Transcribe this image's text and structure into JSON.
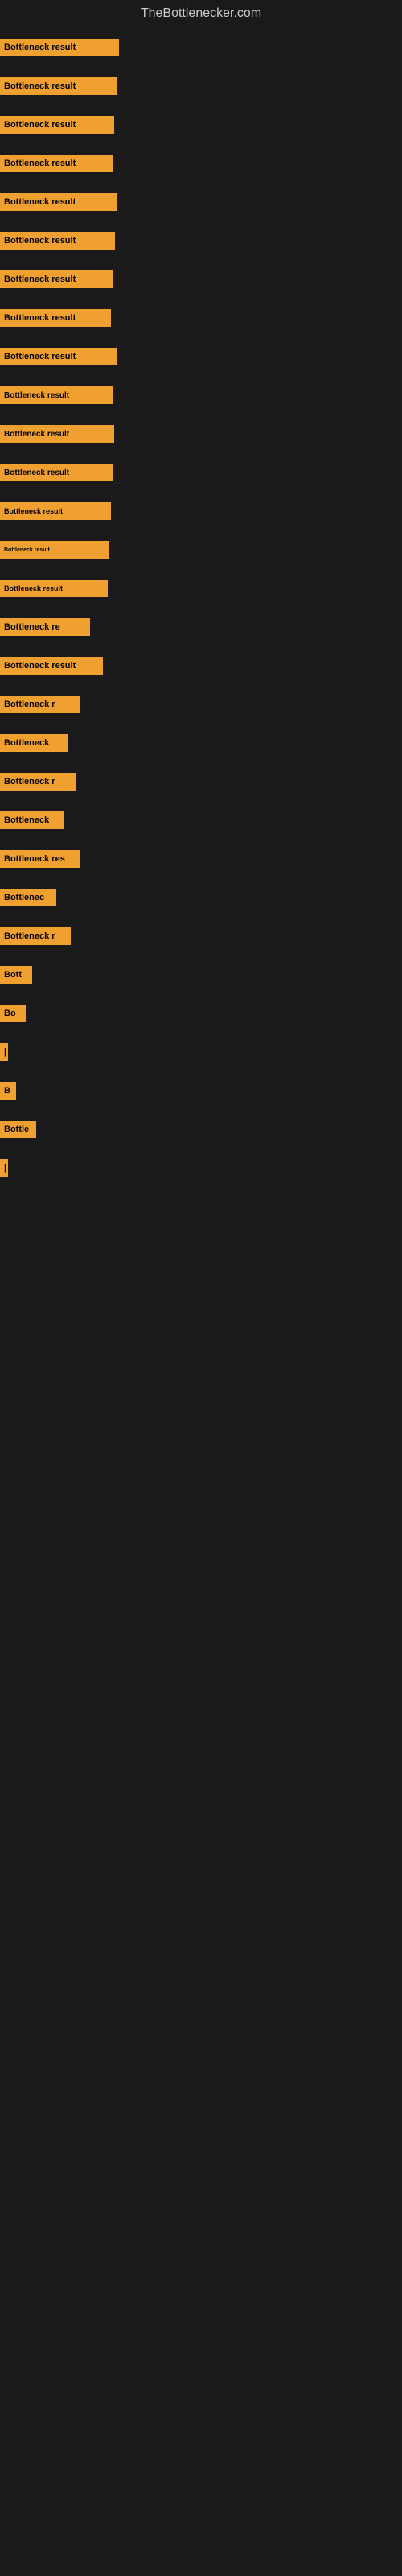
{
  "site": {
    "title": "TheBottlenecker.com"
  },
  "bars": [
    {
      "label": "Bottleneck result",
      "width": 148
    },
    {
      "label": "Bottleneck result",
      "width": 145
    },
    {
      "label": "Bottleneck result",
      "width": 142
    },
    {
      "label": "Bottleneck result",
      "width": 140
    },
    {
      "label": "Bottleneck result",
      "width": 145
    },
    {
      "label": "Bottleneck result",
      "width": 143
    },
    {
      "label": "Bottleneck result",
      "width": 140
    },
    {
      "label": "Bottleneck result",
      "width": 138
    },
    {
      "label": "Bottleneck result",
      "width": 145
    },
    {
      "label": "Bottleneck result",
      "width": 140
    },
    {
      "label": "Bottleneck result",
      "width": 142
    },
    {
      "label": "Bottleneck result",
      "width": 140
    },
    {
      "label": "Bottleneck result",
      "width": 138
    },
    {
      "label": "Bottleneck result",
      "width": 136
    },
    {
      "label": "Bottleneck result",
      "width": 134
    },
    {
      "label": "Bottleneck re",
      "width": 112
    },
    {
      "label": "Bottleneck result",
      "width": 128
    },
    {
      "label": "Bottleneck r",
      "width": 100
    },
    {
      "label": "Bottleneck",
      "width": 85
    },
    {
      "label": "Bottleneck r",
      "width": 95
    },
    {
      "label": "Bottleneck",
      "width": 80
    },
    {
      "label": "Bottleneck res",
      "width": 100
    },
    {
      "label": "Bottlenec",
      "width": 70
    },
    {
      "label": "Bottleneck r",
      "width": 88
    },
    {
      "label": "Bott",
      "width": 40
    },
    {
      "label": "Bo",
      "width": 32
    },
    {
      "label": "|",
      "width": 8
    },
    {
      "label": "B",
      "width": 20
    },
    {
      "label": "Bottle",
      "width": 45
    },
    {
      "label": "|",
      "width": 8
    }
  ]
}
